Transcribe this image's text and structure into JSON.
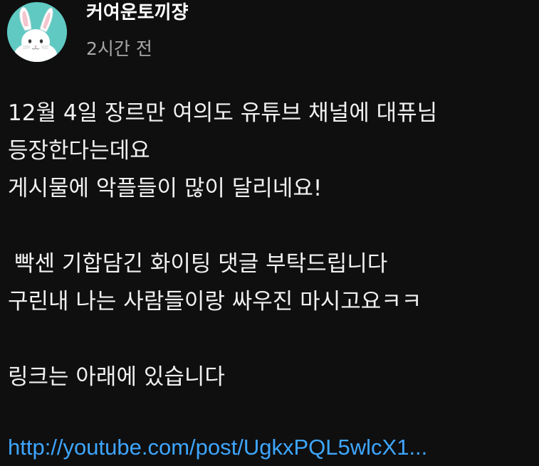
{
  "post": {
    "author": "커여운토끼쟝",
    "time": "2시간 전",
    "avatar_icon": "white-rabbit-avatar",
    "avatar_bg": "#5fc9c2",
    "lines": [
      "12월 4일 장르만 여의도 유튜브 채널에 대퓨님",
      "등장한다는데요",
      "게시물에 악플들이 많이 달리네요!",
      "",
      "빡센 기합담긴 화이팅 댓글 부탁드립니다",
      "구린내 나는 사람들이랑 싸우진 마시고요ㅋㅋ",
      "",
      "링크는 아래에 있습니다"
    ],
    "link": "http://youtube.com/post/UgkxPQL5wlcX1...",
    "link_color": "#3ea6ff"
  }
}
